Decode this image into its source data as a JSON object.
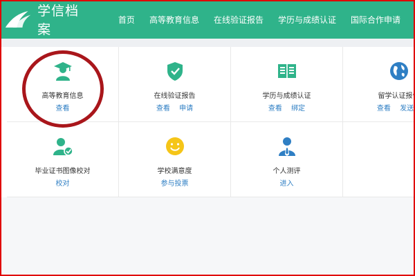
{
  "header": {
    "brand": "学信档案",
    "nav": [
      "首页",
      "高等教育信息",
      "在线验证报告",
      "学历与成绩认证",
      "国际合作申请"
    ],
    "bg_color": "#2fb38a"
  },
  "cards": [
    {
      "title": "高等教育信息",
      "icon": "graduate-icon",
      "links": [
        "查看"
      ]
    },
    {
      "title": "在线验证报告",
      "icon": "shield-check-icon",
      "links": [
        "查看",
        "申请"
      ]
    },
    {
      "title": "学历与成绩认证",
      "icon": "certificate-icon",
      "links": [
        "查看",
        "绑定"
      ]
    },
    {
      "title": "留学认证报告",
      "icon": "globe-icon",
      "links": [
        "查看",
        "发送报"
      ]
    },
    {
      "title": "毕业证书图像校对",
      "icon": "user-check-icon",
      "links": [
        "校对"
      ]
    },
    {
      "title": "学校满意度",
      "icon": "smiley-icon",
      "links": [
        "参与投票"
      ]
    },
    {
      "title": "个人测评",
      "icon": "person-tie-icon",
      "links": [
        "进入"
      ]
    }
  ],
  "colors": {
    "accent": "#2fb38a",
    "link": "#2f7fc4",
    "annotation": "#a9161b",
    "frame": "#e00000"
  }
}
